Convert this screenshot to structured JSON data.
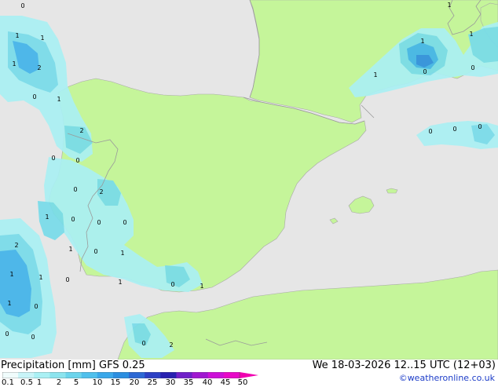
{
  "map": {
    "colors": {
      "sea": "#e6e6e6",
      "land": "#c5f59a",
      "border": "#9a9a9a",
      "coast": "#a8a8a8",
      "precip_light": "#aaf0f4",
      "precip_mid": "#78dcea",
      "precip_strong": "#42b4ea",
      "precip_heavy": "#2f8fe0"
    },
    "labels": [
      {
        "text": "0"
      },
      {
        "text": "1"
      },
      {
        "text": "1"
      },
      {
        "text": "1"
      },
      {
        "text": "2"
      },
      {
        "text": "0"
      },
      {
        "text": "1"
      },
      {
        "text": "2"
      },
      {
        "text": "0"
      },
      {
        "text": "0"
      },
      {
        "text": "0"
      },
      {
        "text": "2"
      },
      {
        "text": "1"
      },
      {
        "text": "0"
      },
      {
        "text": "0"
      },
      {
        "text": "0"
      },
      {
        "text": "2"
      },
      {
        "text": "1"
      },
      {
        "text": "0"
      },
      {
        "text": "1"
      },
      {
        "text": "1"
      },
      {
        "text": "1"
      },
      {
        "text": "0"
      },
      {
        "text": "1"
      },
      {
        "text": "0"
      },
      {
        "text": "1"
      },
      {
        "text": "1"
      },
      {
        "text": "0"
      },
      {
        "text": "0"
      },
      {
        "text": "0"
      },
      {
        "text": "0"
      },
      {
        "text": "2"
      },
      {
        "text": "1"
      },
      {
        "text": "1"
      },
      {
        "text": "0"
      },
      {
        "text": "1"
      },
      {
        "text": "1"
      },
      {
        "text": "0"
      },
      {
        "text": "0"
      },
      {
        "text": "0"
      },
      {
        "text": "0"
      }
    ]
  },
  "footer": {
    "title_left": "Precipitation [mm]  GFS 0.25",
    "title_right": "We 18-03-2026 12..15 UTC (12+03)",
    "credit": "©weatheronline.co.uk"
  },
  "legend": {
    "ticks": [
      "0.1",
      "0.5",
      "1",
      "2",
      "5",
      "10",
      "15",
      "20",
      "25",
      "30",
      "35",
      "40",
      "45",
      "50"
    ],
    "colors": [
      "#f0fcfc",
      "#c8f4f8",
      "#aaf0f4",
      "#8ce4ee",
      "#6cd4ec",
      "#50c0ec",
      "#3aa8ea",
      "#2c8ee0",
      "#2c68d4",
      "#2c40c4",
      "#2820b0",
      "#7020c8",
      "#a018d0",
      "#cc10d8",
      "#e808c8",
      "#f000b0"
    ]
  }
}
